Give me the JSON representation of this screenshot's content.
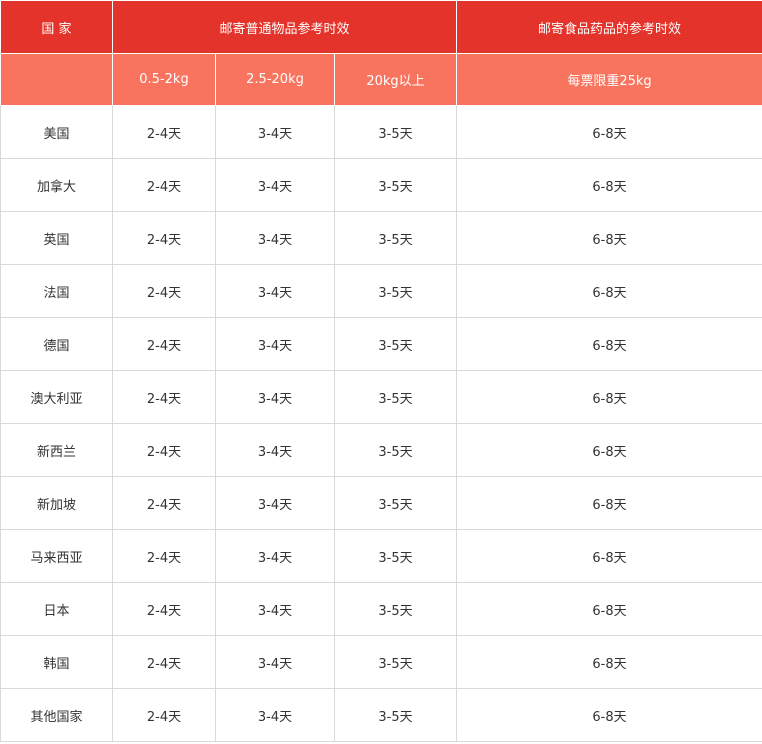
{
  "header": {
    "country": "国 家",
    "normal_goods": "邮寄普通物品参考时效",
    "food_medicine": "邮寄食品药品的参考时效"
  },
  "subheader": {
    "blank": "",
    "w1": "0.5-2kg",
    "w2": "2.5-20kg",
    "w3": "20kg以上",
    "limit": "每票限重25kg"
  },
  "rows": [
    {
      "country": "美国",
      "t1": "2-4天",
      "t2": "3-4天",
      "t3": "3-5天",
      "food": "6-8天"
    },
    {
      "country": "加拿大",
      "t1": "2-4天",
      "t2": "3-4天",
      "t3": "3-5天",
      "food": "6-8天"
    },
    {
      "country": "英国",
      "t1": "2-4天",
      "t2": "3-4天",
      "t3": "3-5天",
      "food": "6-8天"
    },
    {
      "country": "法国",
      "t1": "2-4天",
      "t2": "3-4天",
      "t3": "3-5天",
      "food": "6-8天"
    },
    {
      "country": "德国",
      "t1": "2-4天",
      "t2": "3-4天",
      "t3": "3-5天",
      "food": "6-8天"
    },
    {
      "country": "澳大利亚",
      "t1": "2-4天",
      "t2": "3-4天",
      "t3": "3-5天",
      "food": "6-8天"
    },
    {
      "country": "新西兰",
      "t1": "2-4天",
      "t2": "3-4天",
      "t3": "3-5天",
      "food": "6-8天"
    },
    {
      "country": "新加坡",
      "t1": "2-4天",
      "t2": "3-4天",
      "t3": "3-5天",
      "food": "6-8天"
    },
    {
      "country": "马来西亚",
      "t1": "2-4天",
      "t2": "3-4天",
      "t3": "3-5天",
      "food": "6-8天"
    },
    {
      "country": "日本",
      "t1": "2-4天",
      "t2": "3-4天",
      "t3": "3-5天",
      "food": "6-8天"
    },
    {
      "country": "韩国",
      "t1": "2-4天",
      "t2": "3-4天",
      "t3": "3-5天",
      "food": "6-8天"
    },
    {
      "country": "其他国家",
      "t1": "2-4天",
      "t2": "3-4天",
      "t3": "3-5天",
      "food": "6-8天"
    }
  ]
}
